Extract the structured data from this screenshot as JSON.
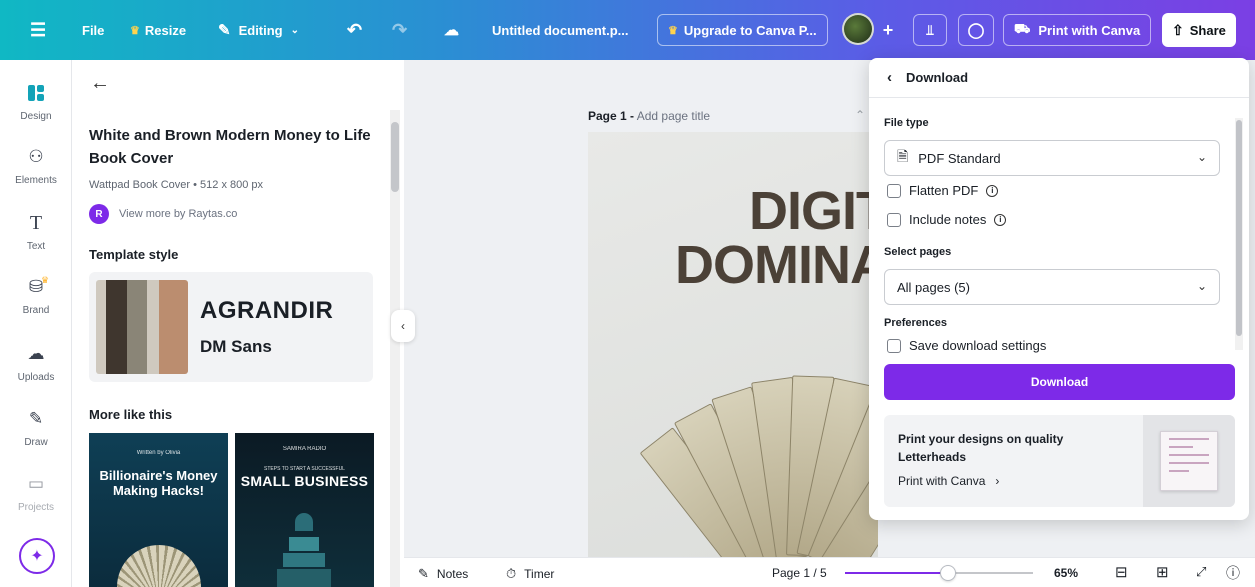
{
  "topbar": {
    "file": "File",
    "resize": "Resize",
    "editing": "Editing",
    "doc_title": "Untitled document.p...",
    "upgrade": "Upgrade to Canva P...",
    "print": "Print with Canva",
    "share": "Share"
  },
  "rail": {
    "items": [
      {
        "label": "Design",
        "icon": "design-icon"
      },
      {
        "label": "Elements",
        "icon": "elements-icon"
      },
      {
        "label": "Text",
        "icon": "text-icon"
      },
      {
        "label": "Brand",
        "icon": "brand-icon"
      },
      {
        "label": "Uploads",
        "icon": "uploads-icon"
      },
      {
        "label": "Draw",
        "icon": "draw-icon"
      },
      {
        "label": "Projects",
        "icon": "projects-icon"
      }
    ]
  },
  "panel": {
    "title": "White and Brown Modern Money to Life Book Cover",
    "meta": "Wattpad Book Cover • 512 x 800 px",
    "author_initial": "R",
    "author": "View more by Raytas.co",
    "template_style": "Template style",
    "font_heading": "AGRANDIR",
    "font_body": "DM Sans",
    "swatches": [
      "#3f362e",
      "#8a8577",
      "#cfc9bf",
      "#bb8d6f"
    ],
    "more_like_this": "More like this",
    "thumbs": [
      {
        "small": "Written by Olivia",
        "big": "Billionaire's Money Making Hacks!"
      },
      {
        "small": "SAMIRA RADIO",
        "sub": "STEPS TO START A SUCCESSFUL",
        "big": "SMALL BUSINESS"
      }
    ]
  },
  "canvas": {
    "page_label": "Page 1 -",
    "page_title_placeholder": "Add page title",
    "headline_1": "DIGIT",
    "headline_2": "DOMINA"
  },
  "bottombar": {
    "notes": "Notes",
    "timer": "Timer",
    "page": "Page 1 / 5",
    "zoom": "65%",
    "zoom_fraction": 0.55
  },
  "download": {
    "title": "Download",
    "file_type_label": "File type",
    "file_type_value": "PDF Standard",
    "flatten": "Flatten PDF",
    "include_notes": "Include notes",
    "select_pages_label": "Select pages",
    "pages_value": "All pages (5)",
    "preferences_label": "Preferences",
    "save_settings": "Save download settings",
    "button": "Download",
    "promo_title": "Print your designs on quality Letterheads",
    "promo_link": "Print with Canva"
  },
  "colors": {
    "accent": "#7d2ae8"
  }
}
